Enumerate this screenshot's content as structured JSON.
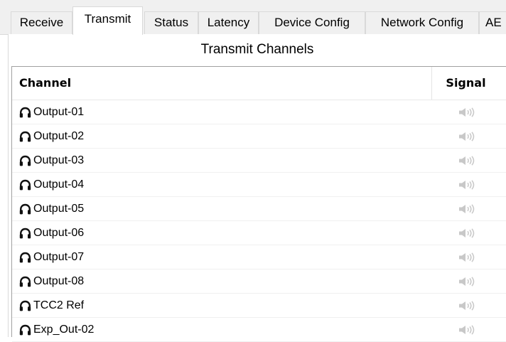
{
  "tabs": [
    {
      "label": "Receive",
      "active": false
    },
    {
      "label": "Transmit",
      "active": true
    },
    {
      "label": "Status",
      "active": false
    },
    {
      "label": "Latency",
      "active": false
    },
    {
      "label": "Device Config",
      "active": false
    },
    {
      "label": "Network Config",
      "active": false
    },
    {
      "label": "AE",
      "active": false
    }
  ],
  "panel": {
    "title": "Transmit Channels"
  },
  "table": {
    "columns": {
      "channel": "Channel",
      "signal": "Signal"
    },
    "rows": [
      {
        "label": "Output-01",
        "icon": "headphones-icon",
        "signal": "speaker-icon"
      },
      {
        "label": "Output-02",
        "icon": "headphones-icon",
        "signal": "speaker-icon"
      },
      {
        "label": "Output-03",
        "icon": "headphones-icon",
        "signal": "speaker-icon"
      },
      {
        "label": "Output-04",
        "icon": "headphones-icon",
        "signal": "speaker-icon"
      },
      {
        "label": "Output-05",
        "icon": "headphones-icon",
        "signal": "speaker-icon"
      },
      {
        "label": "Output-06",
        "icon": "headphones-icon",
        "signal": "speaker-icon"
      },
      {
        "label": "Output-07",
        "icon": "headphones-icon",
        "signal": "speaker-icon"
      },
      {
        "label": "Output-08",
        "icon": "headphones-icon",
        "signal": "speaker-icon"
      },
      {
        "label": "TCC2 Ref",
        "icon": "headphones-icon",
        "signal": "speaker-icon"
      },
      {
        "label": "Exp_Out-02",
        "icon": "headphones-icon",
        "signal": "speaker-icon"
      }
    ]
  },
  "colors": {
    "window_background": "#f0f0f0",
    "panel_background": "#ffffff",
    "border": "#d9d9d9",
    "signal_inactive": "#c8c8c8"
  }
}
